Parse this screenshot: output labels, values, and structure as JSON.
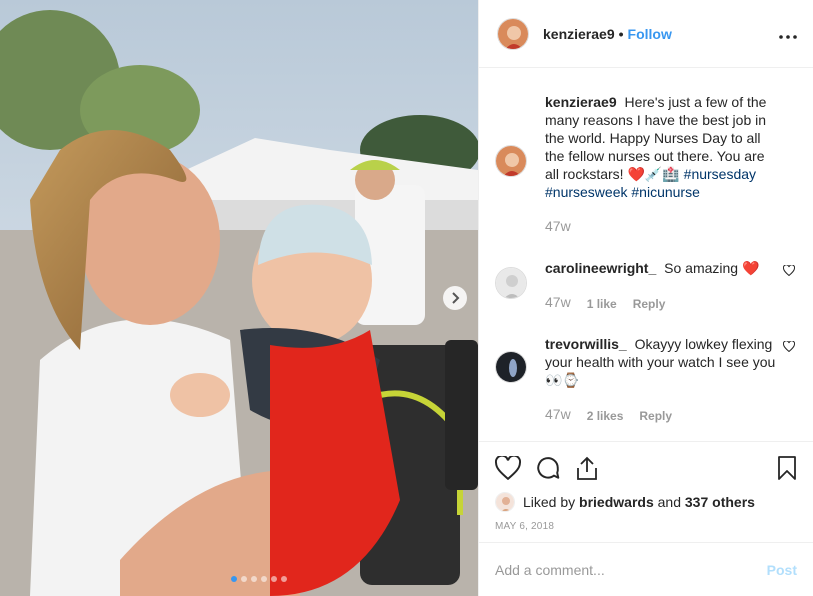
{
  "post": {
    "username": "kenzierae9",
    "separator": "•",
    "follow_label": "Follow",
    "more_label": "•••",
    "photo_description_icon": "photo",
    "carousel": {
      "total": 6,
      "active": 0
    }
  },
  "caption": {
    "username": "kenzierae9",
    "text": "Here's just a few of the many reasons I have the best job in the world. Happy Nurses Day to all the fellow nurses out there. You are all rockstars! ❤️💉🏥 ",
    "hashtags": [
      "#nursesday",
      "#nursesweek",
      "#nicunurse"
    ],
    "time": "47w"
  },
  "comments": [
    {
      "username": "carolineewright_",
      "text": "So amazing ❤️",
      "time": "47w",
      "likes": "1 like",
      "reply": "Reply"
    },
    {
      "username": "trevorwillis_",
      "text": "Okayyy lowkey flexing your health with your watch I see you 👀⌚",
      "time": "47w",
      "likes": "2 likes",
      "reply": "Reply"
    }
  ],
  "likes": {
    "prefix": "Liked by",
    "user": "briedwards",
    "connector": "and",
    "others": "337 others"
  },
  "date": "MAY 6, 2018",
  "add_comment": {
    "placeholder": "Add a comment...",
    "post_label": "Post"
  },
  "colors": {
    "accent": "#3897f0",
    "hashtag": "#003569",
    "post_disabled": "#b2dffc",
    "heart": "#ed4956"
  }
}
